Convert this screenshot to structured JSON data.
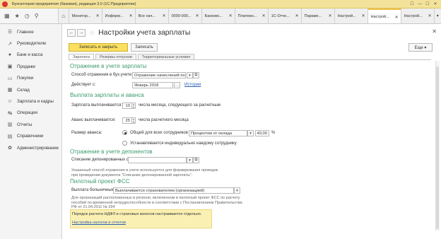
{
  "window": {
    "title": "Бухгалтерия предприятия (базовая), редакция 3.0  (1С:Предприятие)",
    "icons": [
      "☐",
      "—",
      "☐",
      "✕"
    ]
  },
  "tabs": [
    {
      "label": "Монитор..."
    },
    {
      "label": "Информ..."
    },
    {
      "label": "Все нач..."
    },
    {
      "label": "0000-000..."
    },
    {
      "label": "Банковс..."
    },
    {
      "label": "Платежн..."
    },
    {
      "label": "1С-Отче..."
    },
    {
      "label": "Параме..."
    },
    {
      "label": "Настрой..."
    },
    {
      "label": "Настрой..."
    },
    {
      "label": "Настрой..."
    }
  ],
  "sidebar": {
    "items": [
      {
        "label": "Главное",
        "icon": "☰"
      },
      {
        "label": "Руководителю",
        "icon": "↗"
      },
      {
        "label": "Банк и касса",
        "icon": "●"
      },
      {
        "label": "Продажи",
        "icon": "▣"
      },
      {
        "label": "Покупки",
        "icon": "▭"
      },
      {
        "label": "Склад",
        "icon": "▦"
      },
      {
        "label": "Зарплата и кадры",
        "icon": "☺"
      },
      {
        "label": "Операции",
        "icon": "↹"
      },
      {
        "label": "Отчеты",
        "icon": "▥"
      },
      {
        "label": "Справочники",
        "icon": "▤"
      },
      {
        "label": "Администрирование",
        "icon": "✿"
      }
    ]
  },
  "form": {
    "title": "Настройки учета зарплаты",
    "save_close": "Записать и закрыть",
    "save": "Записать",
    "more": "Еще ▾",
    "subtabs": [
      "Зарплата",
      "Резервы отпусков",
      "Территориальные условия"
    ],
    "sections": {
      "reflection": "Отражение в учете зарплаты",
      "payment": "Выплата зарплаты и аванса",
      "deponents": "Отражение в учете депонентов",
      "fss": "Пилотный проект ФСС"
    },
    "fields": {
      "reflection_label": "Способ отражения в бух.учете:",
      "reflection_value": "Отражение начислений по у",
      "effective_label": "Действует с:",
      "effective_value": "Январь 2018",
      "history_link": "История",
      "salary_day_label": "Зарплата выплачивается:",
      "salary_day_value": "10",
      "salary_day_suffix": "числа месяца, следующего за расчетным",
      "advance_day_label": "Аванс выплачивается:",
      "advance_day_value": "25",
      "advance_day_suffix": "числа расчетного месяца",
      "advance_size_label": "Размер аванса:",
      "radio_common": "Общий для всех сотрудников",
      "advance_method": "Процентом от оклада",
      "advance_percent": "40,00",
      "percent_sign": "%",
      "radio_individual": "Устанавливается индивидуально каждому сотруднику",
      "deponent_label": "Списание депонированных сумм:",
      "deponent_value": "",
      "deponent_note_1": "Указанный способ отражения в учете используется для формирования проводок",
      "deponent_note_2": "при проведении документа \"Списание депонированной зарплаты\".",
      "sick_pay_label": "Выплата больничных:",
      "sick_pay_value": "Выплачивается страхователем (организацией)",
      "fss_note_1": "Для организаций расположенных в регионе, включенном в пилотный проект ФСС по расчету",
      "fss_note_2": "пособий по временной нетрудоспособности в соответствии с Постановлением Правительства",
      "fss_note_3": "РФ от 21.04.2011 № 294",
      "info_text": "Порядок расчета НДФЛ и страховых взносов настраивается отдельно.",
      "info_link": "Настройка налогов и отчетов"
    }
  }
}
